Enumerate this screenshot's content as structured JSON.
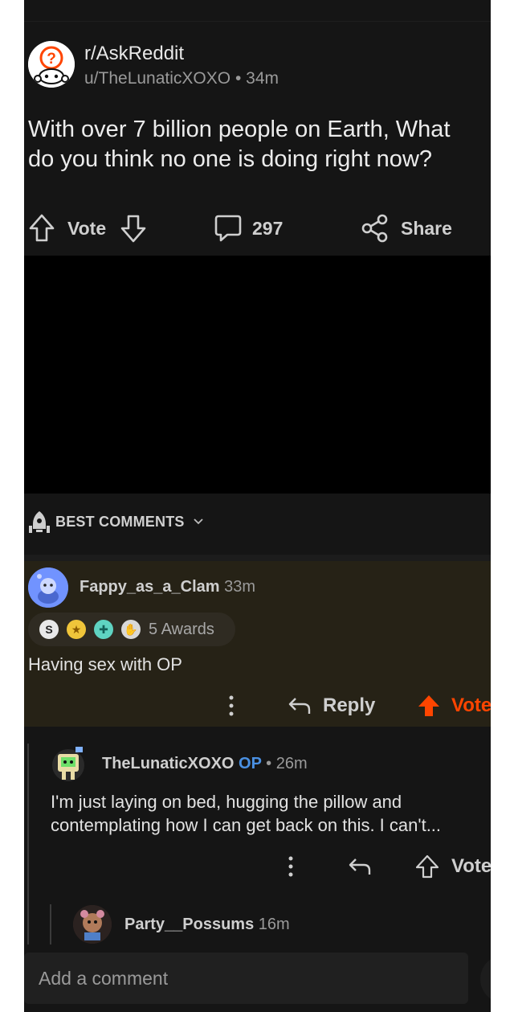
{
  "post": {
    "subreddit": "r/AskReddit",
    "author": "u/TheLunaticXOXO",
    "separator": "•",
    "age": "34m",
    "title_line1": "With over 7 billion people on Earth, What",
    "title_line2": "do you think no one is doing right now?"
  },
  "actions": {
    "vote_label": "Vote",
    "comments_count": "297",
    "share_label": "Share"
  },
  "sort": {
    "label": "BEST COMMENTS"
  },
  "comments": [
    {
      "author": "Fappy_as_a_Clam",
      "age": "33m",
      "awards_label": "5 Awards",
      "body": "Having sex with OP",
      "reply_label": "Reply",
      "vote_label": "Vote"
    },
    {
      "author": "TheLunaticXOXO",
      "op_badge": "OP",
      "separator": "•",
      "age": "26m",
      "body_line1": "I'm just laying on bed, hugging the pillow and",
      "body_line2": "contemplating how I can get back on this. I can't...",
      "vote_label": "Vote"
    },
    {
      "author": "Party__Possums",
      "age": "16m"
    }
  ],
  "composer": {
    "placeholder": "Add a comment"
  },
  "colors": {
    "background": "#151515",
    "highlight": "#262216",
    "upvote_orange": "#ff4500",
    "op_blue": "#4a90e2"
  }
}
